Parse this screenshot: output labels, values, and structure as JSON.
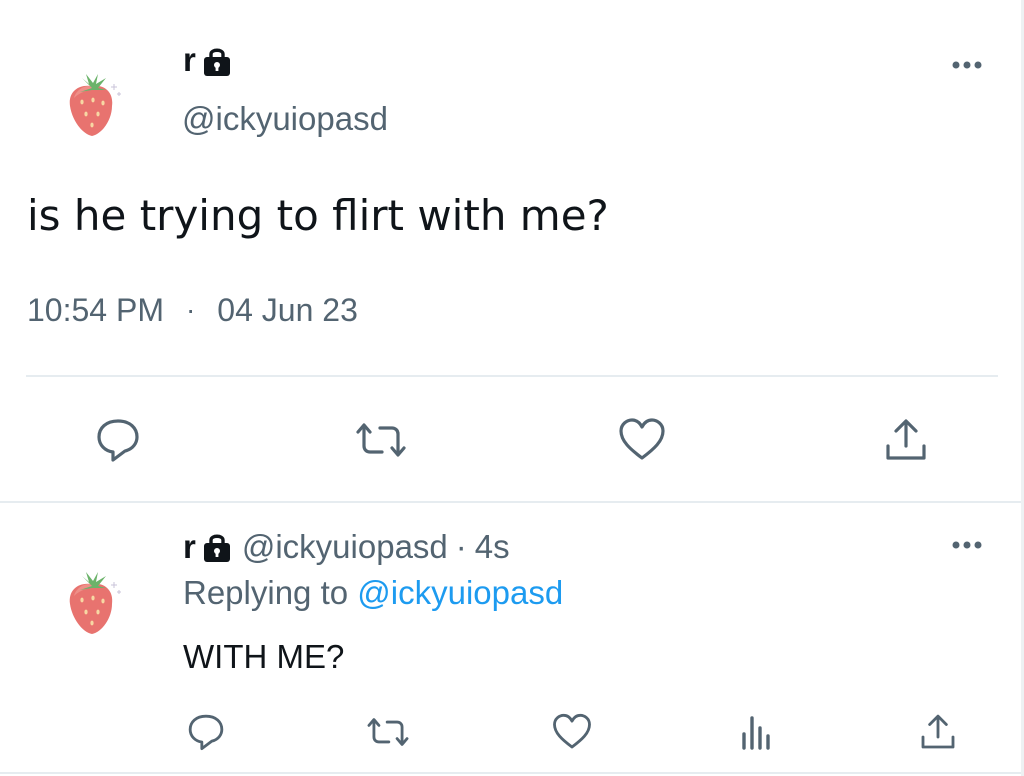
{
  "tweet": {
    "display_name": "r",
    "handle": "@ickyuiopasd",
    "text": "is he trying to flirt with me?",
    "time": "10:54 PM",
    "separator": "·",
    "date": "04 Jun 23",
    "protected_icon": "lock-icon",
    "more_icon": "more-options-icon",
    "actions": [
      "reply-icon",
      "retweet-icon",
      "like-icon",
      "share-icon"
    ]
  },
  "reply": {
    "display_name": "r",
    "handle": "@ickyuiopasd",
    "separator": "·",
    "time_ago": "4s",
    "replying_prefix": "Replying to",
    "replying_to": "@ickyuiopasd",
    "text": "WITH ME?",
    "protected_icon": "lock-icon",
    "more_icon": "more-options-icon",
    "actions": [
      "reply-icon",
      "retweet-icon",
      "like-icon",
      "analytics-icon",
      "share-icon"
    ]
  },
  "colors": {
    "text_primary": "#0f1419",
    "text_secondary": "#536471",
    "link": "#1d9bf0",
    "divider": "#e6ecf0",
    "avatar_strawberry": "#e8736f",
    "avatar_leaves": "#6bb36a"
  }
}
